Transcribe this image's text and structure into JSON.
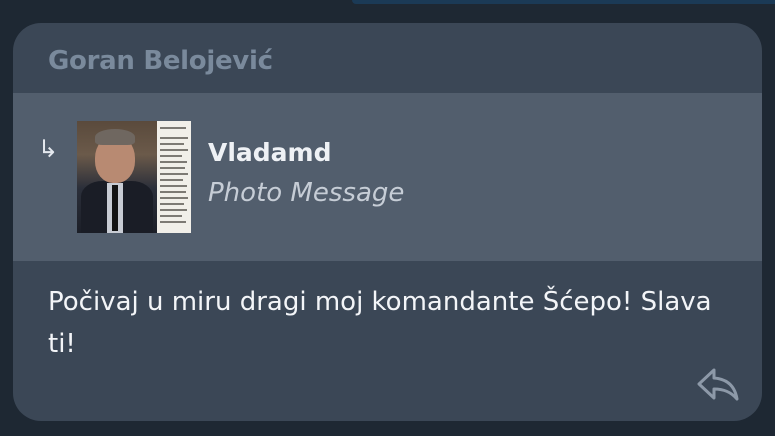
{
  "message": {
    "sender_name": "Goran Belojević",
    "reply_indicator_icon": "reply-arrow-icon",
    "reply_indicator_glyph": "↳",
    "reply": {
      "author": "Vladamd",
      "preview_text": "Photo Message",
      "thumbnail_icon": "photo-thumbnail"
    },
    "text": "Počivaj u miru dragi moj komandante Šćepo! Slava ti!",
    "action_icon": "reply-icon"
  },
  "colors": {
    "background": "#1e2833",
    "bubble": "#3b4756",
    "reply_block": "#525e6d",
    "sender_name": "#7a8a9c",
    "text": "#f3f5f8"
  }
}
